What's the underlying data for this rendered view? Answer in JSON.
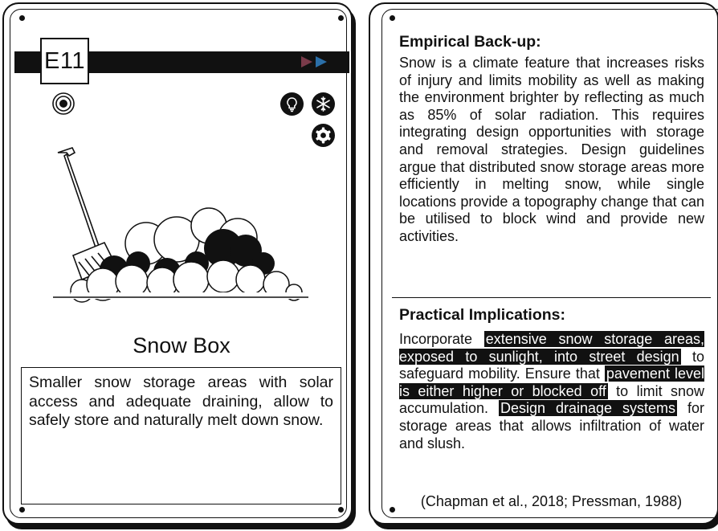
{
  "left_card": {
    "code": "E11",
    "accent_colors": [
      "#7a3b4a",
      "#2b6fa8"
    ],
    "icons": [
      "target-icon",
      "lightbulb-icon",
      "snowflake-icon",
      "gear-icon"
    ],
    "title": "Snow Box",
    "description": "Smaller snow storage areas with solar access and adequate draining, allow to safely store and naturally melt down snow."
  },
  "right_card": {
    "empirical": {
      "heading": "Empirical Back-up:",
      "text": "Snow is a climate feature that increases risks of injury and limits mobility as well as making the environment brighter by reflecting as much as 85% of solar radiation. This requires integrating design opportunities with storage and removal strategies. Design guidelines argue that distributed snow storage areas more efficiently in melting snow, while single locations provide a topography change that can be utilised to block wind and provide new activities."
    },
    "practical": {
      "heading": "Practical Implications:",
      "seg1": "Incorporate ",
      "hl1": "extensive snow storage areas, exposed to sunlight, into street design",
      "seg2": " to safeguard mobility. Ensure that ",
      "hl2": "pavement level is either higher or blocked off",
      "seg3": " to limit snow accumulation. ",
      "hl3": "Design drainage systems",
      "seg4": " for storage areas that allows infiltration of water and slush."
    },
    "reference": "(Chapman et al., 2018; Pressman, 1988)"
  }
}
